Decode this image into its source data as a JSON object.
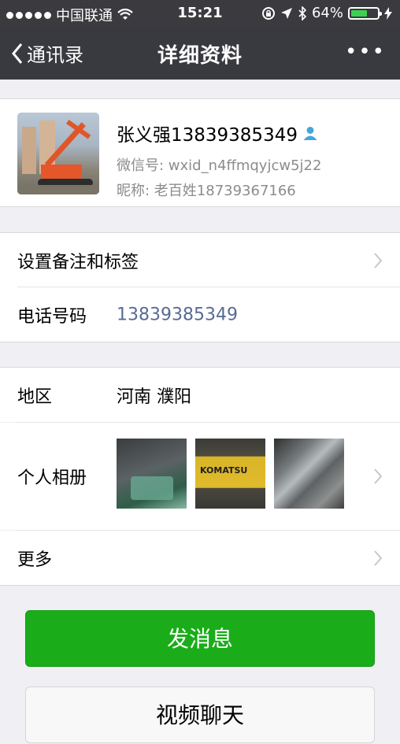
{
  "status_bar": {
    "carrier": "中国联通",
    "time": "15:21",
    "battery": "64%",
    "battery_level": 0.64
  },
  "nav": {
    "back_label": "通讯录",
    "title": "详细资料",
    "more_label": "•••"
  },
  "profile": {
    "name": "张义强13839385349",
    "wechat_id": "微信号:  wxid_n4ffmqyjcw5j22",
    "nickname": "昵称:  老百姓18739367166"
  },
  "rows": {
    "remark_label": "设置备注和标签",
    "phone_label": "电话号码",
    "phone_value": "13839385349",
    "region_label": "地区",
    "region_value": "河南  濮阳",
    "album_label": "个人相册",
    "more_label": "更多"
  },
  "album": {
    "thumb2_text": "KOMATSU"
  },
  "buttons": {
    "send_message": "发消息",
    "video_call": "视频聊天"
  },
  "colors": {
    "primary_green": "#1aad19",
    "link_blue": "#576b95",
    "navbar_bg": "#393a3f"
  }
}
